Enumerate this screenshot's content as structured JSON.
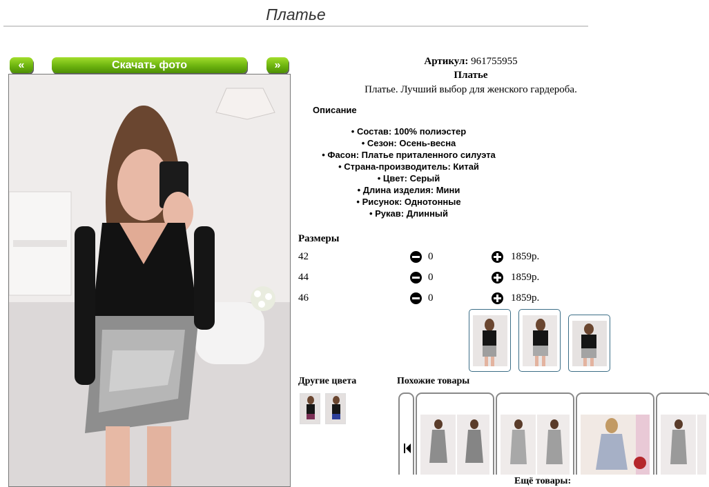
{
  "page": {
    "title": "Платье"
  },
  "nav": {
    "prev_label": "«",
    "download_label": "Скачать фото",
    "next_label": "»"
  },
  "product": {
    "article_label": "Артикул:",
    "article_value": "961755955",
    "name": "Платье",
    "tagline": "Платье. Лучший выбор для женского гардероба."
  },
  "description": {
    "heading": "Описание",
    "items": [
      "Состав: 100% полиэстер",
      "Сезон: Осень-весна",
      "Фасон: Платье приталенного силуэта",
      "Страна-производитель: Китай",
      "Цвет: Серый",
      "Длина изделия: Мини",
      "Рисунок: Однотонные",
      "Рукав: Длинный"
    ]
  },
  "sizes": {
    "heading": "Размеры",
    "rows": [
      {
        "size": "42",
        "qty": "0",
        "price": "1859р."
      },
      {
        "size": "44",
        "qty": "0",
        "price": "1859р."
      },
      {
        "size": "46",
        "qty": "0",
        "price": "1859р."
      }
    ]
  },
  "other_colors": {
    "heading": "Другие цвета"
  },
  "similar": {
    "heading": "Похожие товары",
    "more_label": "Ещё товары:"
  },
  "icons": {
    "minus": "minus-circle-icon",
    "plus": "plus-circle-icon",
    "carousel_first": "skip-first-icon"
  },
  "colors": {
    "button_green": "#6cb30f",
    "thumb_border": "#3a6d86",
    "title_gray": "#333333"
  }
}
